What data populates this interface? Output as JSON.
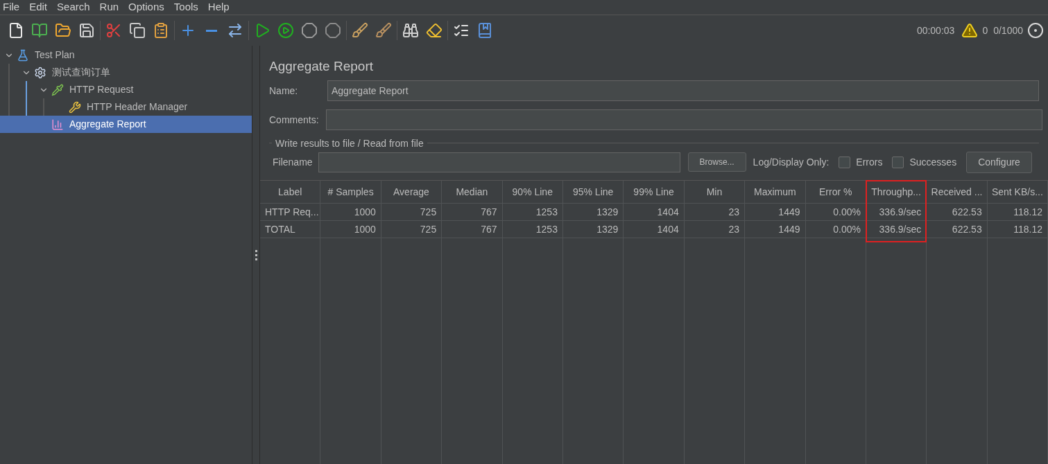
{
  "menu": [
    "File",
    "Edit",
    "Search",
    "Run",
    "Options",
    "Tools",
    "Help"
  ],
  "status": {
    "elapsed": "00:00:03",
    "warnings": "0",
    "threads": "0/1000"
  },
  "tree": [
    {
      "label": "Test Plan",
      "kind": "plan",
      "expanded": true,
      "selected": false,
      "children": [
        {
          "label": "测试查询订单",
          "kind": "group",
          "expanded": true,
          "selected": false,
          "children": [
            {
              "label": "HTTP Request",
              "kind": "sampler",
              "expanded": true,
              "selected": false,
              "children": [
                {
                  "label": "HTTP Header Manager",
                  "kind": "config",
                  "selected": false
                }
              ]
            },
            {
              "label": "Aggregate Report",
              "kind": "listener",
              "selected": true
            }
          ]
        }
      ]
    }
  ],
  "panel": {
    "title": "Aggregate Report",
    "name_label": "Name:",
    "name_value": "Aggregate Report",
    "comments_label": "Comments:",
    "file_group": {
      "legend": "Write results to file / Read from file",
      "filename_label": "Filename",
      "browse": "Browse...",
      "log_label": "Log/Display Only:",
      "checkboxes": [
        {
          "label": "Errors",
          "checked": false
        },
        {
          "label": "Successes",
          "checked": false
        }
      ],
      "configure": "Configure"
    }
  },
  "table": {
    "columns": [
      {
        "label": "Label",
        "highlighted": false
      },
      {
        "label": "# Samples",
        "highlighted": false
      },
      {
        "label": "Average",
        "highlighted": false
      },
      {
        "label": "Median",
        "highlighted": false
      },
      {
        "label": "90% Line",
        "highlighted": false
      },
      {
        "label": "95% Line",
        "highlighted": false
      },
      {
        "label": "99% Line",
        "highlighted": false
      },
      {
        "label": "Min",
        "highlighted": false
      },
      {
        "label": "Maximum",
        "highlighted": false
      },
      {
        "label": "Error %",
        "highlighted": false
      },
      {
        "label": "Throughp...",
        "highlighted": true
      },
      {
        "label": "Received ...",
        "highlighted": false
      },
      {
        "label": "Sent KB/s...",
        "highlighted": false
      }
    ],
    "rows": [
      [
        "HTTP Req...",
        "1000",
        "725",
        "767",
        "1253",
        "1329",
        "1404",
        "23",
        "1449",
        "0.00%",
        "336.9/sec",
        "622.53",
        "118.12"
      ],
      [
        "TOTAL",
        "1000",
        "725",
        "767",
        "1253",
        "1329",
        "1404",
        "23",
        "1449",
        "0.00%",
        "336.9/sec",
        "622.53",
        "118.12"
      ]
    ]
  }
}
